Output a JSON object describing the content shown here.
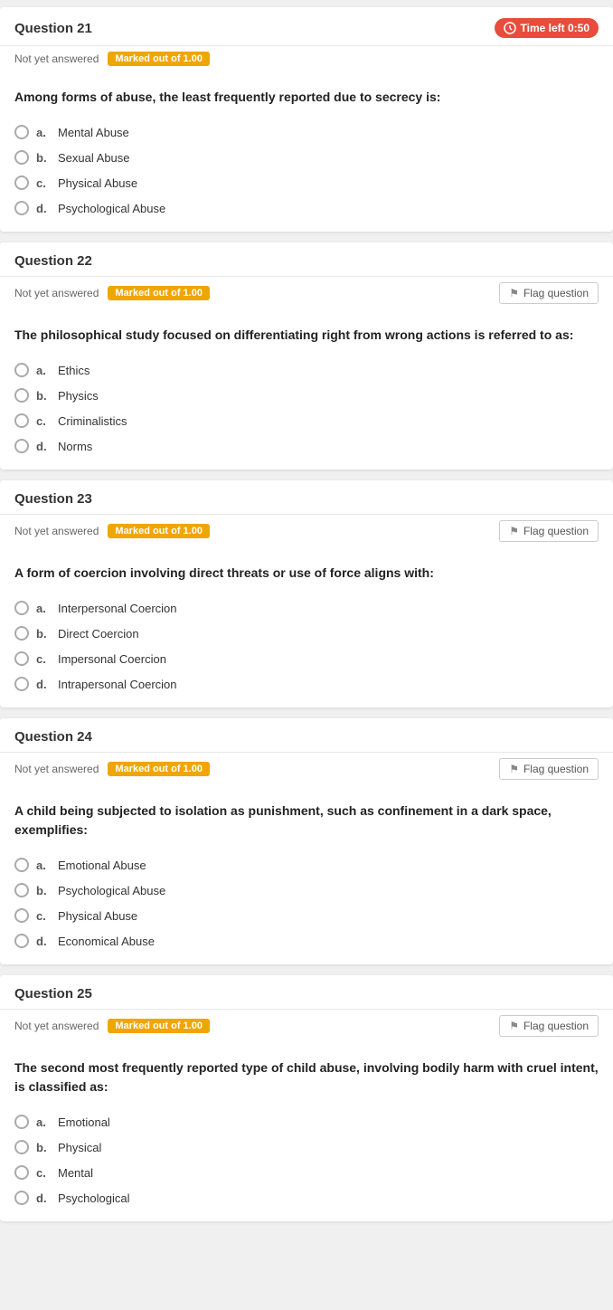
{
  "questions": [
    {
      "id": "q21",
      "number": "Question 21",
      "status": "Not yet answered",
      "mark": "Marked out of 1.00",
      "timer": "Time left 0:50",
      "show_flag": false,
      "show_timer": true,
      "text": "Among forms of abuse, the least frequently reported due to secrecy is:",
      "options": [
        {
          "letter": "a.",
          "text": "Mental Abuse"
        },
        {
          "letter": "b.",
          "text": "Sexual Abuse"
        },
        {
          "letter": "c.",
          "text": "Physical Abuse"
        },
        {
          "letter": "d.",
          "text": "Psychological Abuse"
        }
      ]
    },
    {
      "id": "q22",
      "number": "Question 22",
      "status": "Not yet answered",
      "mark": "Marked out of 1.00",
      "timer": "",
      "show_flag": true,
      "show_timer": false,
      "text": "The philosophical study focused on differentiating right from wrong actions is referred to as:",
      "options": [
        {
          "letter": "a.",
          "text": "Ethics"
        },
        {
          "letter": "b.",
          "text": "Physics"
        },
        {
          "letter": "c.",
          "text": "Criminalistics"
        },
        {
          "letter": "d.",
          "text": "Norms"
        }
      ]
    },
    {
      "id": "q23",
      "number": "Question 23",
      "status": "Not yet answered",
      "mark": "Marked out of 1.00",
      "timer": "",
      "show_flag": true,
      "show_timer": false,
      "text": "A form of coercion involving direct threats or use of force aligns with:",
      "options": [
        {
          "letter": "a.",
          "text": "Interpersonal Coercion"
        },
        {
          "letter": "b.",
          "text": "Direct Coercion"
        },
        {
          "letter": "c.",
          "text": "Impersonal Coercion"
        },
        {
          "letter": "d.",
          "text": "Intrapersonal Coercion"
        }
      ]
    },
    {
      "id": "q24",
      "number": "Question 24",
      "status": "Not yet answered",
      "mark": "Marked out of 1.00",
      "timer": "",
      "show_flag": true,
      "show_timer": false,
      "text": "A child being subjected to isolation as punishment, such as confinement in a dark space, exemplifies:",
      "options": [
        {
          "letter": "a.",
          "text": "Emotional Abuse"
        },
        {
          "letter": "b.",
          "text": "Psychological Abuse"
        },
        {
          "letter": "c.",
          "text": "Physical Abuse"
        },
        {
          "letter": "d.",
          "text": "Economical Abuse"
        }
      ]
    },
    {
      "id": "q25",
      "number": "Question 25",
      "status": "Not yet answered",
      "mark": "Marked out of 1.00",
      "timer": "",
      "show_flag": true,
      "show_timer": false,
      "text": "The second most frequently reported type of child abuse, involving bodily harm with cruel intent, is classified as:",
      "options": [
        {
          "letter": "a.",
          "text": "Emotional"
        },
        {
          "letter": "b.",
          "text": "Physical"
        },
        {
          "letter": "c.",
          "text": "Mental"
        },
        {
          "letter": "d.",
          "text": "Psychological"
        }
      ]
    }
  ],
  "labels": {
    "flag_question": "Flag question",
    "not_answered": "Not yet answered"
  }
}
